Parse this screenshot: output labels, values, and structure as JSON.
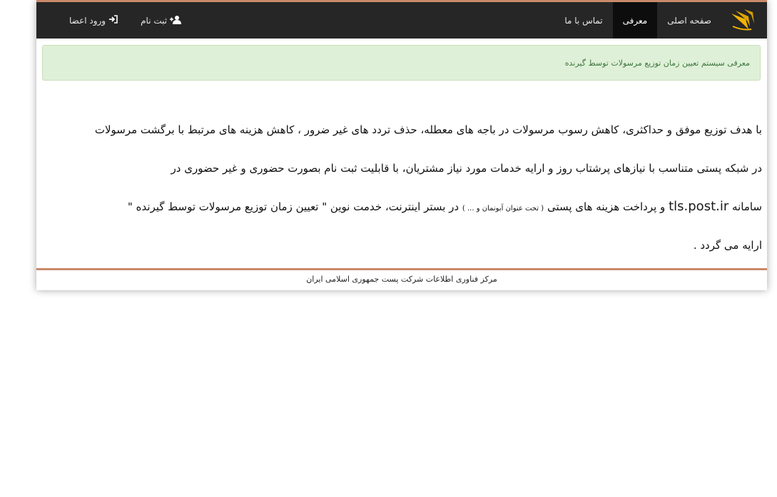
{
  "nav": {
    "items": [
      {
        "label": "صفحه اصلی",
        "active": false
      },
      {
        "label": "معرفی",
        "active": true
      },
      {
        "label": "تماس با ما",
        "active": false
      }
    ],
    "register_label": "ثبت نام",
    "login_label": "ورود اعضا",
    "register_icon": "user-plus-icon",
    "login_icon": "sign-in-icon"
  },
  "alert": {
    "text": "معرفی سیستم تعیین زمان توزیع مرسولات توسط گیرنده"
  },
  "content": {
    "line1": "با هدف توزیع موفق و حداکثری، کاهش رسوب مرسولات در باجه های معطله، حذف تردد های غیر ضرور ، کاهش هزینه های مرتبط با برگشت مرسولات",
    "line2": "در شبکه پستی متناسب با نیازهای پرشتاب روز و ارایه خدمات مورد نیاز مشتریان، با قابلیت ثبت نام بصورت حضوری و غیر حضوری در",
    "line3_a": "سامانه",
    "line3_site": "tls.post.ir",
    "line3_b": "و پرداخت هزینه های پستی",
    "line3_note": "( تحت عنوان آبونمان و ... )",
    "line3_c": "در بستر اینترنت، خدمت نوین \" تعیین زمان توزیع مرسولات توسط گیرنده \"",
    "line4": "ارایه می گردد ."
  },
  "footer": {
    "text": "مرکز فناوری اطلاعات شرکت پست جمهوری اسلامی ایران"
  },
  "colors": {
    "topbar": "#262626",
    "accent": "#c98a6b",
    "logo": "#f2b400",
    "alert_bg": "#dff0d8",
    "alert_text": "#3c763d"
  }
}
